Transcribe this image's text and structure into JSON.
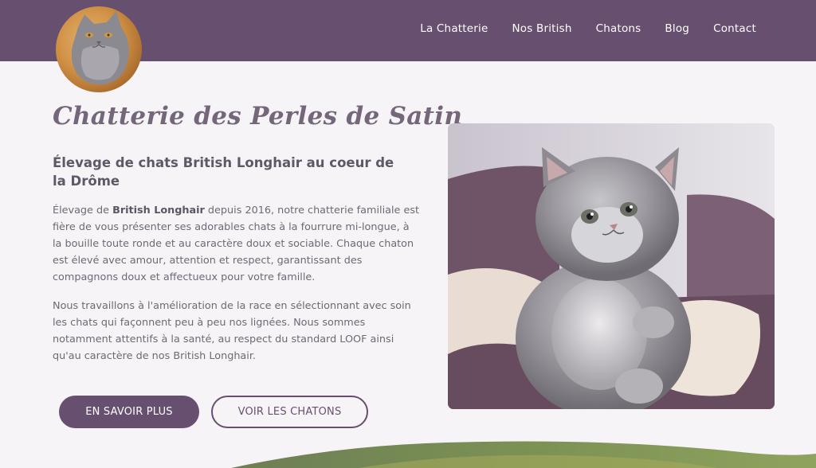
{
  "nav": {
    "items": [
      {
        "label": "La Chatterie"
      },
      {
        "label": "Nos British"
      },
      {
        "label": "Chatons"
      },
      {
        "label": "Blog"
      },
      {
        "label": "Contact"
      }
    ]
  },
  "hero": {
    "title": "Chatterie des Perles de Satin",
    "subtitle": "Élevage de chats British Longhair au coeur de la Drôme",
    "p1_before": "Élevage de ",
    "p1_bold": "British Longhair",
    "p1_after": " depuis 2016, notre chatterie familiale est fière de vous présenter ses adorables chats à la fourrure mi-longue, à la bouille toute ronde et au caractère doux et sociable. Chaque chaton est élevé avec amour, attention et respect, garantissant des compagnons doux et affectueux pour votre famille.",
    "p2": "Nous travaillons à l'amélioration de la race en sélectionnant avec soin les chats qui façonnent peu à peu nos lignées. Nous sommes notamment attentifs à la santé, au respect du standard LOOF ainsi qu'au caractère de nos British Longhair.",
    "btn_primary": "EN SAVOIR PLUS",
    "btn_secondary": "VOIR LES CHATONS"
  },
  "colors": {
    "brand": "#67506f",
    "background": "#f7f4f8",
    "logo_moon": "#d19a52"
  },
  "icons": {
    "logo": "cat-moon-logo",
    "photo": "grey-kitten-photo"
  }
}
